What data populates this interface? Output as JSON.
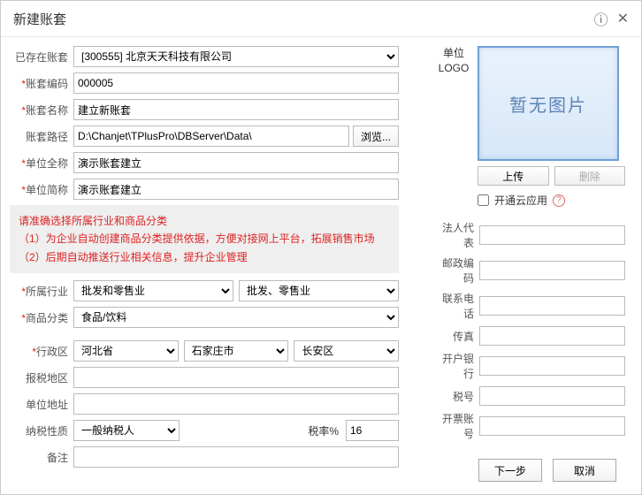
{
  "window": {
    "title": "新建账套"
  },
  "left": {
    "existing_label": "已存在账套",
    "existing_value": "[300555] 北京天天科技有限公司",
    "code_label": "账套编码",
    "code_value": "000005",
    "name_label": "账套名称",
    "name_value": "建立新账套",
    "path_label": "账套路径",
    "path_value": "D:\\Chanjet\\TPlusPro\\DBServer\\Data\\",
    "browse": "浏览...",
    "full_label": "单位全称",
    "full_value": "演示账套建立",
    "short_label": "单位简称",
    "short_value": "演示账套建立",
    "instructions_l1": "请准确选择所属行业和商品分类",
    "instructions_l2": "（1）为企业自动创建商品分类提供依据，方便对接网上平台，拓展销售市场",
    "instructions_l3": "（2）后期自动推送行业相关信息，提升企业管理",
    "industry_label": "所属行业",
    "industry_main": "批发和零售业",
    "industry_sub": "批发、零售业",
    "category_label": "商品分类",
    "category_value": "食品/饮料",
    "region_label": "行政区",
    "region_province": "河北省",
    "region_city": "石家庄市",
    "region_district": "长安区",
    "taxloc_label": "报税地区",
    "address_label": "单位地址",
    "taxtype_label": "纳税性质",
    "taxtype_value": "一般纳税人",
    "taxrate_label": "税率%",
    "taxrate_value": "16",
    "remark_label": "备注"
  },
  "right": {
    "logo_label_l1": "单位",
    "logo_label_l2": "LOGO",
    "logo_placeholder": "暂无图片",
    "upload": "上传",
    "delete": "删除",
    "cloud_label": "开通云应用",
    "fields": {
      "legal": "法人代表",
      "zip": "邮政编码",
      "phone": "联系电话",
      "fax": "传真",
      "bank": "开户银行",
      "taxno": "税号",
      "invoice": "开票账号"
    }
  },
  "footer": {
    "next": "下一步",
    "cancel": "取消"
  }
}
